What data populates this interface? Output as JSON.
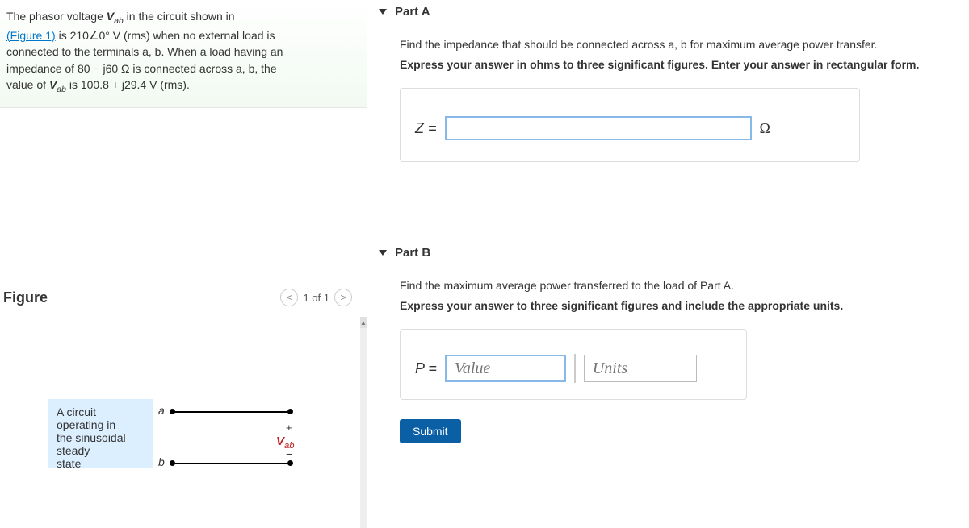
{
  "problem": {
    "line1_a": "The phasor voltage ",
    "vab_bold": "V",
    "vab_sub": "ab",
    "line1_b": " in the circuit shown in",
    "fig_link": "(Figure 1)",
    "line2_a": " is 210∠0° V (rms) when no external load is",
    "line3": "connected to the terminals a, b. When a load having an",
    "line4": "impedance of 80 − j60 Ω is connected across a, b, the",
    "line5_a": "value of ",
    "line5_b": " is 100.8 + j29.4 V (rms)."
  },
  "figure": {
    "title": "Figure",
    "pager": "1 of 1",
    "box_l1": "A circuit",
    "box_l2": "operating in",
    "box_l3": "the sinusoidal",
    "box_l4": "steady",
    "box_l5": "state",
    "a": "a",
    "b": "b",
    "plus": "+",
    "minus": "−",
    "v_char": "V",
    "v_sub": "ab"
  },
  "partA": {
    "title": "Part A",
    "prompt": "Find the impedance that should be connected across a, b for maximum average power transfer.",
    "instr": "Express your answer in ohms to three significant figures. Enter your answer in rectangular form.",
    "lhs": "Z =",
    "unit": "Ω"
  },
  "partB": {
    "title": "Part B",
    "prompt": "Find the maximum average power transferred to the load of Part A.",
    "instr": "Express your answer to three significant figures and include the appropriate units.",
    "lhs": "P =",
    "value_ph": "Value",
    "units_ph": "Units",
    "submit": "Submit"
  }
}
